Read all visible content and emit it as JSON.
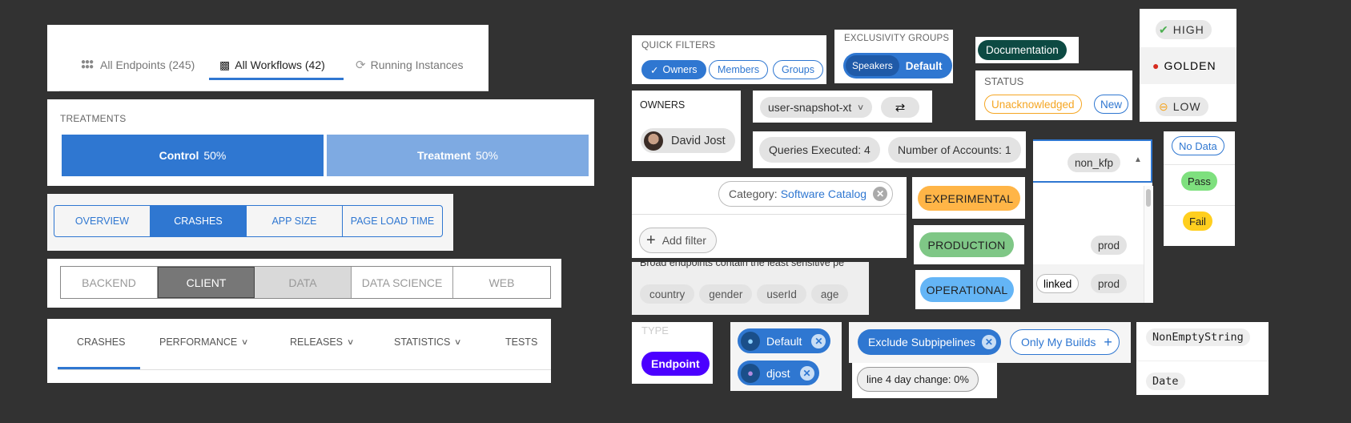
{
  "top_tabs": {
    "items": [
      {
        "label": "All Endpoints (245)",
        "icon": "grid-dots-icon",
        "active": false
      },
      {
        "label": "All Workflows (42)",
        "icon": "hierarchy-icon",
        "active": true
      },
      {
        "label": "Running Instances",
        "icon": "spinner-icon",
        "active": false
      }
    ],
    "accent": "#2f77d1"
  },
  "treatments": {
    "label": "TREATMENTS",
    "items": [
      {
        "name": "Control",
        "pct": "50%",
        "color": "#2f77d1"
      },
      {
        "name": "Treatment",
        "pct": "50%",
        "color": "#7eaae2"
      }
    ]
  },
  "segmented_blue": {
    "items": [
      "OVERVIEW",
      "CRASHES",
      "APP SIZE",
      "PAGE LOAD TIME"
    ],
    "active": "CRASHES"
  },
  "segmented_grey": {
    "items": [
      "BACKEND",
      "CLIENT",
      "DATA",
      "DATA SCIENCE",
      "WEB"
    ],
    "active": "CLIENT",
    "hover": "DATA"
  },
  "nav_tabs": {
    "items": [
      {
        "label": "CRASHES",
        "dropdown": false,
        "active": true
      },
      {
        "label": "PERFORMANCE",
        "dropdown": true
      },
      {
        "label": "RELEASES",
        "dropdown": true
      },
      {
        "label": "STATISTICS",
        "dropdown": true
      },
      {
        "label": "TESTS",
        "dropdown": false
      }
    ]
  },
  "quick_filters": {
    "label": "QUICK FILTERS",
    "items": [
      {
        "label": "Owners",
        "selected": true
      },
      {
        "label": "Members",
        "selected": false
      },
      {
        "label": "Groups",
        "selected": false
      }
    ]
  },
  "exclusivity": {
    "label": "EXCLUSIVITY GROUPS",
    "options": [
      "Speakers",
      "Default"
    ],
    "selected": "Speakers"
  },
  "documentation_badge": "Documentation",
  "status": {
    "label": "STATUS",
    "items": [
      "Unacknowledged",
      "New"
    ]
  },
  "levels": [
    {
      "label": "HIGH",
      "icon": "check-circle-icon"
    },
    {
      "label": "GOLDEN",
      "icon": "chili-pepper-icon"
    },
    {
      "label": "LOW",
      "icon": "minus-circle-icon"
    }
  ],
  "owners": {
    "label": "OWNERS",
    "user": "David Jost"
  },
  "snapshot": {
    "select_value": "user-snapshot-xt",
    "swap_icon": "swap-arrows-icon"
  },
  "queries": {
    "items": [
      "Queries Executed: 4",
      "Number of Accounts: 1"
    ]
  },
  "category_filter": {
    "key": "Category:",
    "value": "Software Catalog",
    "add_label": "Add filter"
  },
  "broad": {
    "description": "Broad endpoints contain the least sensitive pe",
    "fields": [
      "country",
      "gender",
      "userId",
      "age"
    ]
  },
  "environments": [
    "EXPERIMENTAL",
    "PRODUCTION",
    "OPERATIONAL"
  ],
  "dropdown": {
    "selected": "non_kfp",
    "rows": [
      {
        "tags": [
          "prod"
        ]
      },
      {
        "tags": [
          "linked",
          "prod"
        ]
      }
    ]
  },
  "checks": [
    "No Data",
    "Pass",
    "Fail"
  ],
  "type": {
    "label": "TYPE",
    "value": "Endpoint"
  },
  "user_chips": [
    {
      "label": "Default",
      "icon": "whale-emoji-icon"
    },
    {
      "label": "djost",
      "icon": "alien-emoji-icon"
    }
  ],
  "pipeline_filters": {
    "active": "Exclude Subpipelines",
    "inactive": "Only My Builds"
  },
  "change_badge": "line 4 day change: 0%",
  "types": [
    "NonEmptyString",
    "Date"
  ]
}
